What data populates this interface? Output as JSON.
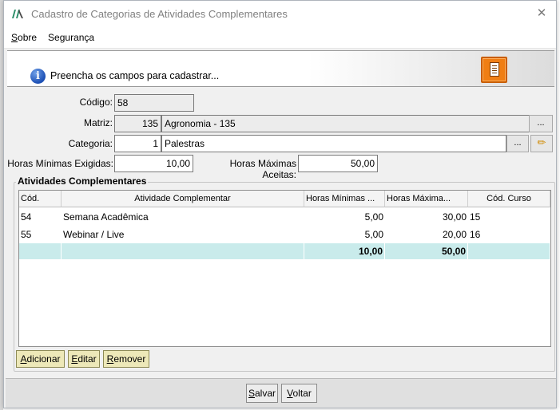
{
  "window": {
    "title": "Cadastro de Categorias de Atividades Complementares",
    "close_glyph": "✕"
  },
  "menu": {
    "sobre_first": "S",
    "sobre_rest": "obre",
    "seguranca": "Segurança"
  },
  "header": {
    "info_text": "Preencha os campos para cadastrar...",
    "info_glyph": "i"
  },
  "form": {
    "codigo_label": "Código:",
    "codigo_value": "58",
    "matriz_label": "Matriz:",
    "matriz_code": "135",
    "matriz_name": "Agronomia - 135",
    "categoria_label": "Categoria:",
    "categoria_code": "1",
    "categoria_name": "Palestras",
    "ellipsis": "...",
    "edit_glyph": "✏",
    "horas_min_label": "Horas Mínimas Exigidas:",
    "horas_min_value": "10,00",
    "horas_max_label": "Horas Máximas Aceitas:",
    "horas_max_value": "50,00"
  },
  "activities": {
    "group_title": "Atividades Complementares",
    "columns": [
      "Cód.",
      "Atividade Complementar",
      "Horas Mínimas ...",
      "Horas Máxima...",
      "Cód. Curso"
    ],
    "rows": [
      {
        "cod": "54",
        "atividade": "Semana Acadêmica",
        "horas_min": "5,00",
        "horas_max": "30,00",
        "cod_curso": "15"
      },
      {
        "cod": "55",
        "atividade": "Webinar / Live",
        "horas_min": "5,00",
        "horas_max": "20,00",
        "cod_curso": "16"
      }
    ],
    "totals": {
      "horas_min": "10,00",
      "horas_max": "50,00"
    }
  },
  "buttons": {
    "adicionar_first": "A",
    "adicionar_rest": "dicionar",
    "editar_first": "E",
    "editar_rest": "ditar",
    "remover_first": "R",
    "remover_rest": "emover",
    "salvar_first": "S",
    "salvar_rest": "alvar",
    "voltar_first": "V",
    "voltar_rest": "oltar"
  },
  "colors": {
    "accent_orange": "#f07e14",
    "total_row": "#c9ebeb",
    "action_button": "#ede8b8"
  }
}
